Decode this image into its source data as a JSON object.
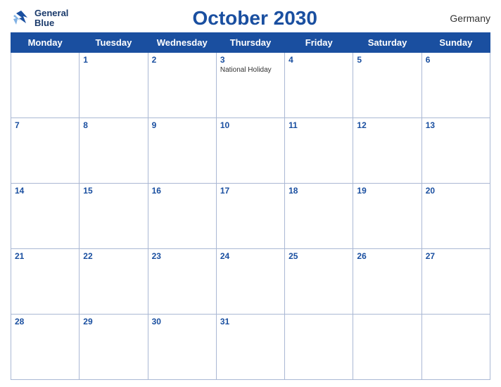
{
  "header": {
    "logo_line1": "General",
    "logo_line2": "Blue",
    "title": "October 2030",
    "country": "Germany"
  },
  "weekdays": [
    "Monday",
    "Tuesday",
    "Wednesday",
    "Thursday",
    "Friday",
    "Saturday",
    "Sunday"
  ],
  "weeks": [
    [
      {
        "day": "",
        "holiday": ""
      },
      {
        "day": "1",
        "holiday": ""
      },
      {
        "day": "2",
        "holiday": ""
      },
      {
        "day": "3",
        "holiday": "National Holiday"
      },
      {
        "day": "4",
        "holiday": ""
      },
      {
        "day": "5",
        "holiday": ""
      },
      {
        "day": "6",
        "holiday": ""
      }
    ],
    [
      {
        "day": "7",
        "holiday": ""
      },
      {
        "day": "8",
        "holiday": ""
      },
      {
        "day": "9",
        "holiday": ""
      },
      {
        "day": "10",
        "holiday": ""
      },
      {
        "day": "11",
        "holiday": ""
      },
      {
        "day": "12",
        "holiday": ""
      },
      {
        "day": "13",
        "holiday": ""
      }
    ],
    [
      {
        "day": "14",
        "holiday": ""
      },
      {
        "day": "15",
        "holiday": ""
      },
      {
        "day": "16",
        "holiday": ""
      },
      {
        "day": "17",
        "holiday": ""
      },
      {
        "day": "18",
        "holiday": ""
      },
      {
        "day": "19",
        "holiday": ""
      },
      {
        "day": "20",
        "holiday": ""
      }
    ],
    [
      {
        "day": "21",
        "holiday": ""
      },
      {
        "day": "22",
        "holiday": ""
      },
      {
        "day": "23",
        "holiday": ""
      },
      {
        "day": "24",
        "holiday": ""
      },
      {
        "day": "25",
        "holiday": ""
      },
      {
        "day": "26",
        "holiday": ""
      },
      {
        "day": "27",
        "holiday": ""
      }
    ],
    [
      {
        "day": "28",
        "holiday": ""
      },
      {
        "day": "29",
        "holiday": ""
      },
      {
        "day": "30",
        "holiday": ""
      },
      {
        "day": "31",
        "holiday": ""
      },
      {
        "day": "",
        "holiday": ""
      },
      {
        "day": "",
        "holiday": ""
      },
      {
        "day": "",
        "holiday": ""
      }
    ]
  ]
}
